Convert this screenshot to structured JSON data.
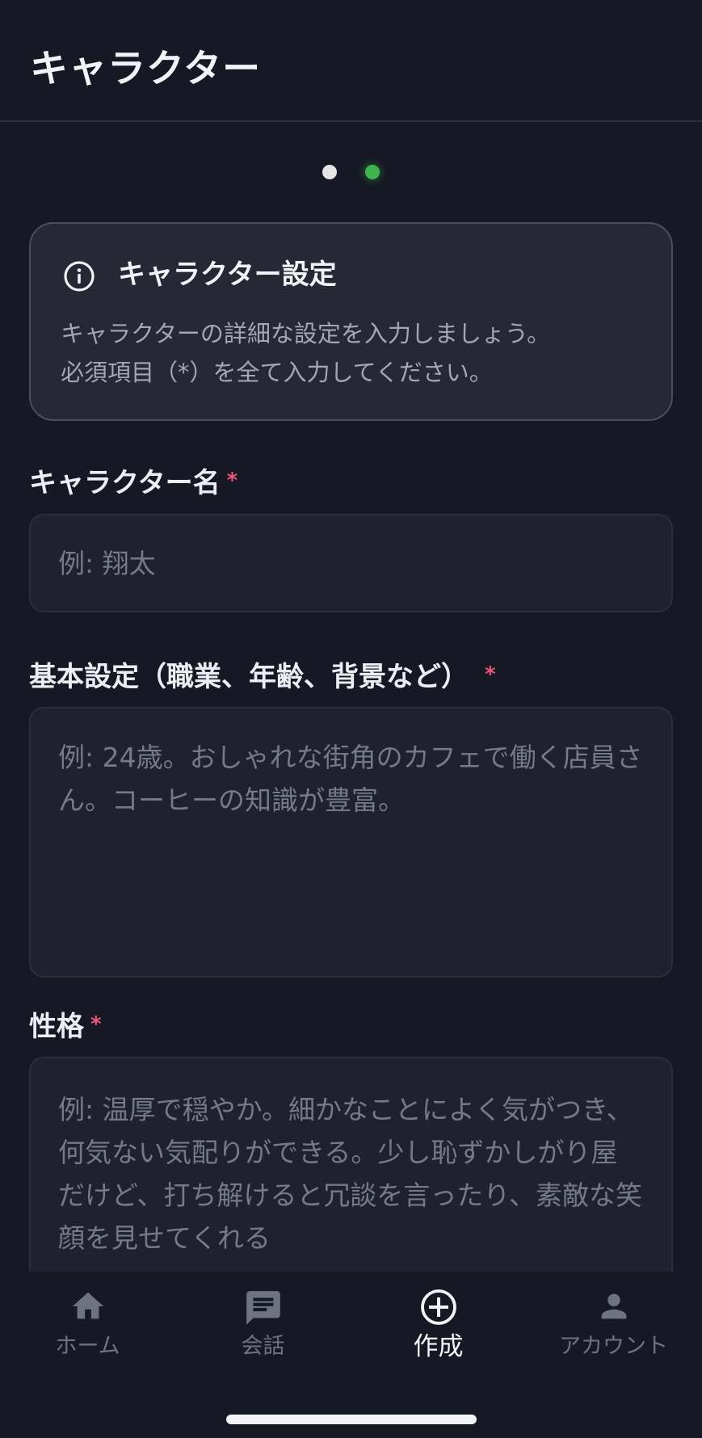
{
  "header": {
    "title": "キャラクター"
  },
  "pager": {
    "total": 2,
    "current": 2
  },
  "info": {
    "icon": "info-icon",
    "title": "キャラクター設定",
    "line1": "キャラクターの詳細な設定を入力しましょう。",
    "line2": "必須項目（*）を全て入力してください。"
  },
  "fields": {
    "name": {
      "label": "キャラクター名",
      "required": "*",
      "placeholder": "例: 翔太"
    },
    "basic": {
      "label": "基本設定（職業、年齢、背景など）",
      "required": "*",
      "placeholder": "例: 24歳。おしゃれな街角のカフェで働く店員さん。コーヒーの知識が豊富。"
    },
    "personality": {
      "label": "性格",
      "required": "*",
      "placeholder": "例: 温厚で穏やか。細かなことによく気がつき、何気ない気配りができる。少し恥ずかしがり屋だけど、打ち解けると冗談を言ったり、素敵な笑顔を見せてくれる"
    }
  },
  "nav": {
    "items": [
      {
        "label": "ホーム",
        "icon": "home-icon"
      },
      {
        "label": "会話",
        "icon": "chat-icon"
      },
      {
        "label": "作成",
        "icon": "add-circle-icon"
      },
      {
        "label": "アカウント",
        "icon": "person-icon"
      }
    ],
    "active_index": 2
  },
  "colors": {
    "background": "#161823",
    "accent": "#3fb44e",
    "required": "#e8577c"
  }
}
